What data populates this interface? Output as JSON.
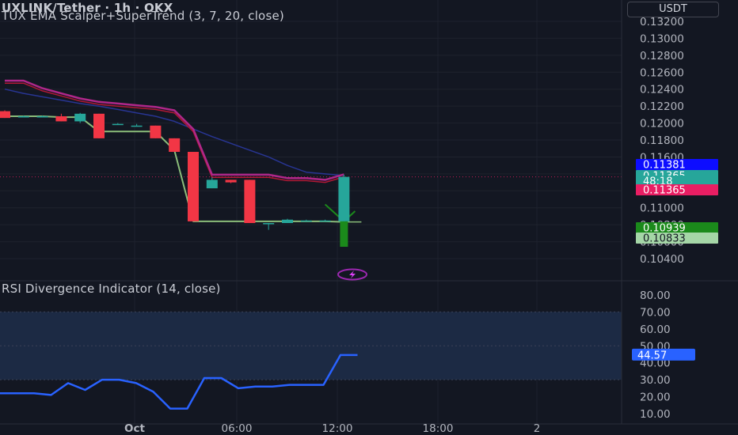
{
  "header": {
    "symbol_line": "UXLINK/Tether · 1h · OKX",
    "indicator_line": "TUX EMA Scalper+SuperTrend (3, 7, 20, close)",
    "rsi_line": "RSI Divergence Indicator (14, close)",
    "currency": "USDT"
  },
  "colors": {
    "background": "#131722",
    "bull": "#26a69a",
    "bear": "#f23645",
    "ema_fast": "#8bbd7a",
    "ema_mid": "#c2185b",
    "ema_slow": "#283593",
    "supertrend_up": "#1b8a1b",
    "rsi_line": "#2962ff",
    "rsi_band": "#1c2a44"
  },
  "chart_data": [
    {
      "type": "candlestick",
      "x_ticks": [
        "Oct",
        "06:00",
        "12:00",
        "18:00",
        "2"
      ],
      "y_ticks": [
        "0.13200",
        "0.13000",
        "0.12800",
        "0.12600",
        "0.12400",
        "0.12200",
        "0.12000",
        "0.11800",
        "0.11600",
        "0.11400",
        "0.11200",
        "0.11000",
        "0.10800",
        "0.10600",
        "0.10400"
      ],
      "ylim": [
        0.1036,
        0.1324
      ],
      "price_labels": [
        {
          "text": "0.11381",
          "value": 0.11381,
          "color": "#0d0dff"
        },
        {
          "text": "0.11365",
          "value": 0.11365,
          "color": "#26a69a"
        },
        {
          "text": "48:18",
          "value": 0.11365,
          "color": "#26a69a"
        },
        {
          "text": "0.11365",
          "value": 0.11365,
          "color": "#e91e63"
        },
        {
          "text": "0.10939",
          "value": 0.10939,
          "color": "#1b8a1b"
        },
        {
          "text": "0.10833",
          "value": 0.10833,
          "color": "#a5d6a7"
        }
      ],
      "candles": [
        {
          "o": 0.1214,
          "h": 0.1215,
          "l": 0.1206,
          "c": 0.1206
        },
        {
          "o": 0.1208,
          "h": 0.1209,
          "l": 0.1208,
          "c": 0.1208
        },
        {
          "o": 0.1208,
          "h": 0.1209,
          "l": 0.1208,
          "c": 0.1208
        },
        {
          "o": 0.1208,
          "h": 0.1211,
          "l": 0.1202,
          "c": 0.1202
        },
        {
          "o": 0.1202,
          "h": 0.1212,
          "l": 0.12,
          "c": 0.1211
        },
        {
          "o": 0.1211,
          "h": 0.1211,
          "l": 0.1182,
          "c": 0.1182
        },
        {
          "o": 0.1198,
          "h": 0.12,
          "l": 0.1198,
          "c": 0.1199
        },
        {
          "o": 0.1197,
          "h": 0.1199,
          "l": 0.1196,
          "c": 0.1197
        },
        {
          "o": 0.1197,
          "h": 0.1197,
          "l": 0.1182,
          "c": 0.1182
        },
        {
          "o": 0.1182,
          "h": 0.1182,
          "l": 0.1166,
          "c": 0.1166
        },
        {
          "o": 0.1166,
          "h": 0.1166,
          "l": 0.1084,
          "c": 0.1084
        },
        {
          "o": 0.1123,
          "h": 0.1136,
          "l": 0.1123,
          "c": 0.1133
        },
        {
          "o": 0.1133,
          "h": 0.1133,
          "l": 0.1129,
          "c": 0.113
        },
        {
          "o": 0.1133,
          "h": 0.1133,
          "l": 0.1082,
          "c": 0.1082
        },
        {
          "o": 0.1082,
          "h": 0.1082,
          "l": 0.1074,
          "c": 0.1082
        },
        {
          "o": 0.1082,
          "h": 0.1087,
          "l": 0.1082,
          "c": 0.1086
        },
        {
          "o": 0.1085,
          "h": 0.1086,
          "l": 0.1085,
          "c": 0.1085
        },
        {
          "o": 0.1085,
          "h": 0.1086,
          "l": 0.1084,
          "c": 0.1085
        },
        {
          "o": 0.1084,
          "h": 0.1139,
          "l": 0.1084,
          "c": 0.11365
        }
      ],
      "ema_fast": [
        0.1208,
        0.1208,
        0.1208,
        0.1207,
        0.1207,
        0.119,
        0.119,
        0.119,
        0.119,
        0.1168,
        0.1084,
        0.1084,
        0.1084,
        0.1084,
        0.1084,
        0.1084,
        0.1084,
        0.1084,
        0.10833
      ],
      "ema_mid": [
        0.1247,
        0.1247,
        0.1238,
        0.1232,
        0.1226,
        0.1222,
        0.122,
        0.1218,
        0.1216,
        0.1212,
        0.119,
        0.1136,
        0.1136,
        0.1136,
        0.1136,
        0.1132,
        0.1132,
        0.113,
        0.11365
      ],
      "ema_slow": [
        0.124,
        0.1235,
        0.1231,
        0.1227,
        0.1223,
        0.122,
        0.1216,
        0.1212,
        0.1208,
        0.1202,
        0.1193,
        0.1184,
        0.1176,
        0.1168,
        0.116,
        0.115,
        0.1142,
        0.114,
        0.11381
      ],
      "supertrend_up": [
        0.1104,
        0.1084,
        0.10939
      ]
    },
    {
      "type": "line",
      "title": "RSI Divergence Indicator (14, close)",
      "y_ticks": [
        "80.00",
        "70.00",
        "60.00",
        "50.00",
        "40.00",
        "30.00",
        "20.00",
        "10.00"
      ],
      "ylim": [
        5,
        82
      ],
      "band": [
        30,
        70
      ],
      "last_label": "44.57",
      "values": [
        22,
        22,
        22,
        21,
        28,
        24,
        30,
        30,
        28,
        23,
        13,
        13,
        31,
        31,
        25,
        26,
        26,
        27,
        27,
        27,
        44.57,
        44.57
      ]
    }
  ]
}
